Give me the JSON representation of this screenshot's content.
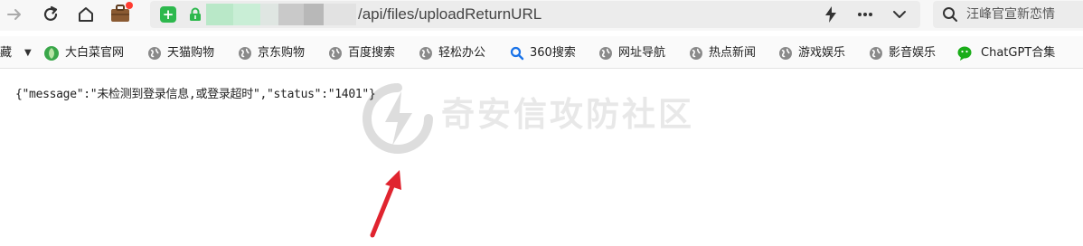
{
  "browser": {
    "address_bar": {
      "url_visible": "/api/files/uploadReturnURL"
    },
    "search_box": {
      "text": "汪峰官宣新恋情"
    }
  },
  "bookmarks": {
    "items": [
      {
        "label": "藏",
        "icon": "text-glyph"
      },
      {
        "label": "大白菜官网",
        "icon": "cabbage-icon",
        "color": "#3aa74a"
      },
      {
        "label": "天猫购物",
        "icon": "globe-icon"
      },
      {
        "label": "京东购物",
        "icon": "globe-icon"
      },
      {
        "label": "百度搜索",
        "icon": "globe-icon"
      },
      {
        "label": "轻松办公",
        "icon": "globe-icon"
      },
      {
        "label": "360搜索",
        "icon": "search-icon",
        "color": "#1a73e8"
      },
      {
        "label": "网址导航",
        "icon": "globe-icon"
      },
      {
        "label": "热点新闻",
        "icon": "globe-icon"
      },
      {
        "label": "游戏娱乐",
        "icon": "globe-icon"
      },
      {
        "label": "影音娱乐",
        "icon": "globe-icon"
      },
      {
        "label": "ChatGPT合集",
        "icon": "chat-bubble-icon",
        "color": "#1aad19"
      }
    ]
  },
  "page": {
    "response_text": "{\"message\":\"未检测到登录信息,或登录超时\",\"status\":\"1401\"}",
    "watermark_text": "奇安信攻防社区"
  },
  "colors": {
    "shield_green": "#2db84d",
    "arrow_red": "#e0242f",
    "notification_red": "#ff3b30"
  }
}
